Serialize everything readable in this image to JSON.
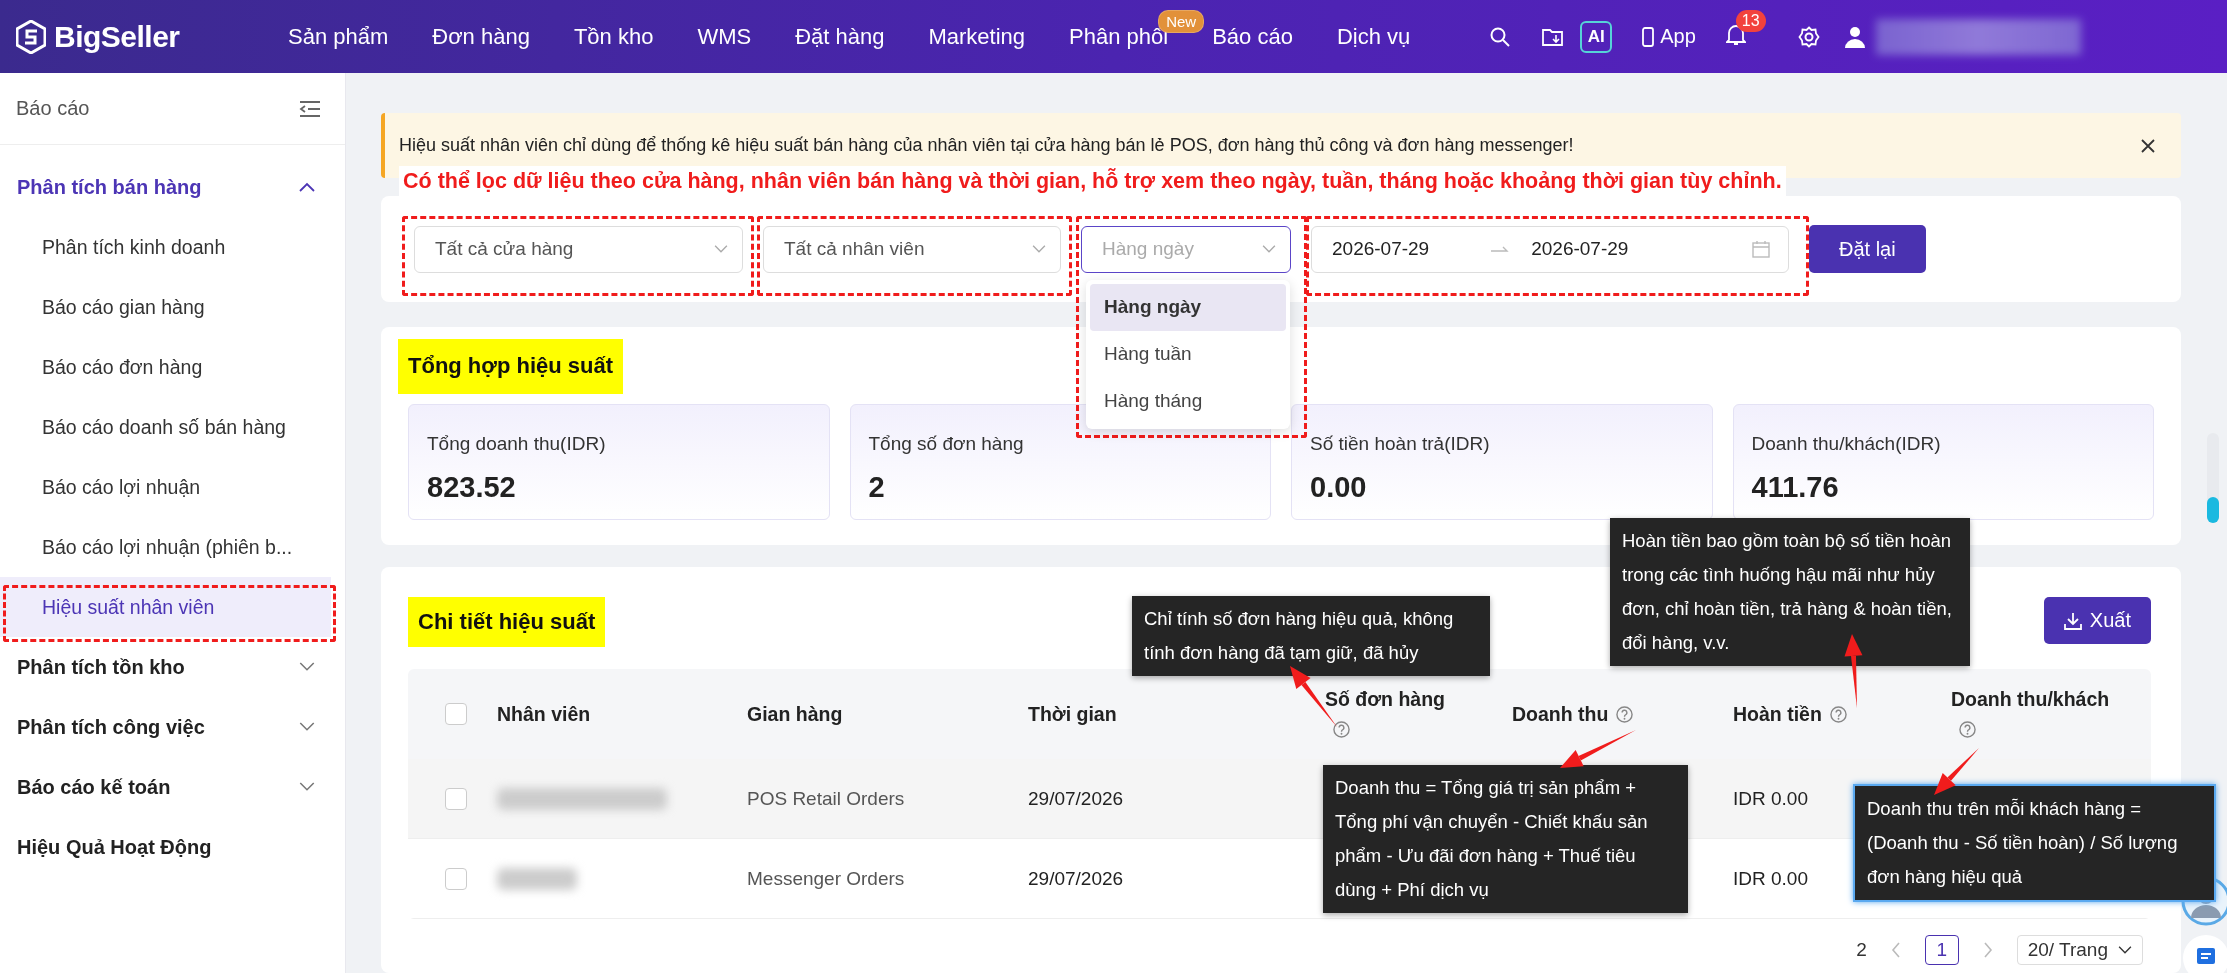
{
  "top_nav": {
    "logo": "BigSeller",
    "menu": [
      {
        "label": "Sản phẩm"
      },
      {
        "label": "Đơn hàng"
      },
      {
        "label": "Tồn kho"
      },
      {
        "label": "WMS"
      },
      {
        "label": "Đặt hàng"
      },
      {
        "label": "Marketing"
      },
      {
        "label": "Phân phối",
        "badge": "New"
      },
      {
        "label": "Báo cáo"
      },
      {
        "label": "Dịch vụ"
      }
    ],
    "ai_button": "AI",
    "app_link": "App",
    "notification_count": "13"
  },
  "sidebar": {
    "title": "Báo cáo",
    "groups": [
      {
        "label": "Phân tích bán hàng",
        "kind": "group",
        "expanded": true,
        "children": [
          {
            "label": "Phân tích kinh doanh",
            "selected": false
          },
          {
            "label": "Báo cáo gian hàng",
            "selected": false
          },
          {
            "label": "Báo cáo đơn hàng",
            "selected": false
          },
          {
            "label": "Báo cáo doanh số bán hàng",
            "selected": false
          },
          {
            "label": "Báo cáo lợi nhuận",
            "selected": false
          },
          {
            "label": "Báo cáo lợi nhuận (phiên b...",
            "selected": false
          },
          {
            "label": "Hiệu suất nhân viên",
            "selected": true
          }
        ]
      },
      {
        "label": "Phân tích tồn kho",
        "kind": "group",
        "expanded": false
      },
      {
        "label": "Phân tích công việc",
        "kind": "group",
        "expanded": false
      },
      {
        "label": "Báo cáo kế toán",
        "kind": "group",
        "expanded": false
      },
      {
        "label": "Hiệu Quả Hoạt Động",
        "kind": "link"
      }
    ]
  },
  "notice": {
    "text": "Hiệu suất nhân viên chỉ dùng để thống kê hiệu suất bán hàng của nhân viên tại cửa hàng bán lẻ POS, đơn hàng thủ công và đơn hàng messenger!"
  },
  "annotation_note": "Có thể lọc dữ liệu theo cửa hàng, nhân viên bán hàng và thời gian, hỗ trợ xem theo ngày, tuần, tháng hoặc khoảng thời gian tùy chỉnh.",
  "filters": {
    "store_select": "Tất cả cửa hàng",
    "staff_select": "Tất cả nhân viên",
    "period_select": {
      "placeholder": "Hàng ngày",
      "open": true,
      "options": [
        {
          "label": "Hàng ngày",
          "selected": true
        },
        {
          "label": "Hàng tuần",
          "selected": false
        },
        {
          "label": "Hàng tháng",
          "selected": false
        }
      ]
    },
    "date_start": "2026-07-29",
    "date_end": "2026-07-29",
    "reset_button": "Đặt lại"
  },
  "summary": {
    "title": "Tổng hợp hiệu suất",
    "stats": [
      {
        "label": "Tổng doanh thu(IDR)",
        "value": "823.52"
      },
      {
        "label": "Tổng số đơn hàng",
        "value": "2"
      },
      {
        "label": "Số tiền hoàn trả(IDR)",
        "value": "0.00"
      },
      {
        "label": "Doanh thu/khách(IDR)",
        "value": "411.76"
      }
    ]
  },
  "details": {
    "title": "Chi tiết hiệu suất",
    "export_button": "Xuất",
    "table": {
      "all_checked": false,
      "columns": [
        {
          "label": "Nhân viên",
          "help": false
        },
        {
          "label": "Gian hàng",
          "help": false
        },
        {
          "label": "Thời gian",
          "help": false
        },
        {
          "label": "Số đơn hàng",
          "help": true
        },
        {
          "label": "Doanh thu",
          "help": true
        },
        {
          "label": "Hoàn tiền",
          "help": true
        },
        {
          "label": "Doanh thu/khách",
          "help": true
        }
      ],
      "rows": [
        {
          "checked": false,
          "store": "POS Retail Orders",
          "time": "29/07/2026",
          "refund": "IDR 0.00"
        },
        {
          "checked": false,
          "store": "Messenger Orders",
          "time": "29/07/2026",
          "refund": "IDR 0.00"
        }
      ]
    },
    "pagination": {
      "total": "2",
      "pages": [
        {
          "label": "1",
          "selected": true
        }
      ],
      "page_size": "20/ Trang"
    }
  },
  "tooltips": [
    {
      "text": "Chỉ tính số đơn hàng hiệu quả, không tính đơn hàng đã tạm giữ, đã hủy"
    },
    {
      "text": "Hoàn tiền bao gồm toàn bộ số tiền hoàn trong các tình huống hậu mãi như hủy đơn, chỉ hoàn tiền, trả hàng & hoàn tiền, đổi hàng, v.v."
    },
    {
      "text": "Doanh thu = Tổng giá trị sản phẩm + Tổng phí vận chuyển - Chiết khấu sản phẩm - Ưu đãi đơn hàng + Thuế tiêu dùng + Phí dịch vụ"
    },
    {
      "text": "Doanh thu trên mỗi khách hàng = (Doanh thu - Số tiền hoàn) / Số lượng đơn hàng hiệu quả"
    }
  ]
}
